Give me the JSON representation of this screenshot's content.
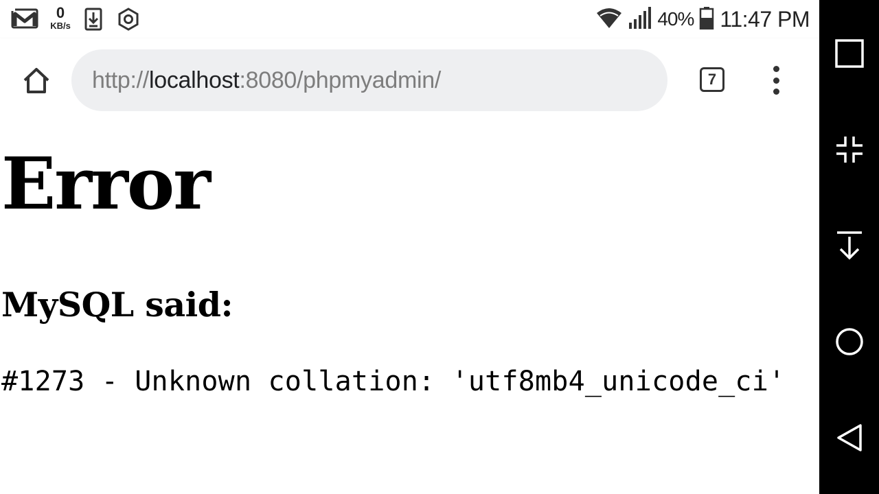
{
  "status_bar": {
    "left_icons": [
      "gmail-icon",
      "download-icon",
      "settings-hex-icon"
    ],
    "net_speed_value": "0",
    "net_speed_unit": "KB/s",
    "battery_percent": "40%",
    "time": "11:47 PM"
  },
  "browser": {
    "url_scheme": "http://",
    "url_host": "localhost",
    "url_rest": ":8080/phpmyadmin/",
    "tab_count": "7"
  },
  "page": {
    "title": "Error",
    "subtitle": "MySQL said:",
    "error_message": "#1273 - Unknown collation: 'utf8mb4_unicode_ci'"
  },
  "nav_bar": {
    "buttons": [
      "recents-square-icon",
      "minimize-icon",
      "hide-bar-icon",
      "home-circle-icon",
      "back-triangle-icon"
    ]
  },
  "colors": {
    "nav_bar_bg": "#000000",
    "url_bar_bg": "#eeeff1",
    "url_muted": "#7d7d7d",
    "url_host": "#202124"
  }
}
